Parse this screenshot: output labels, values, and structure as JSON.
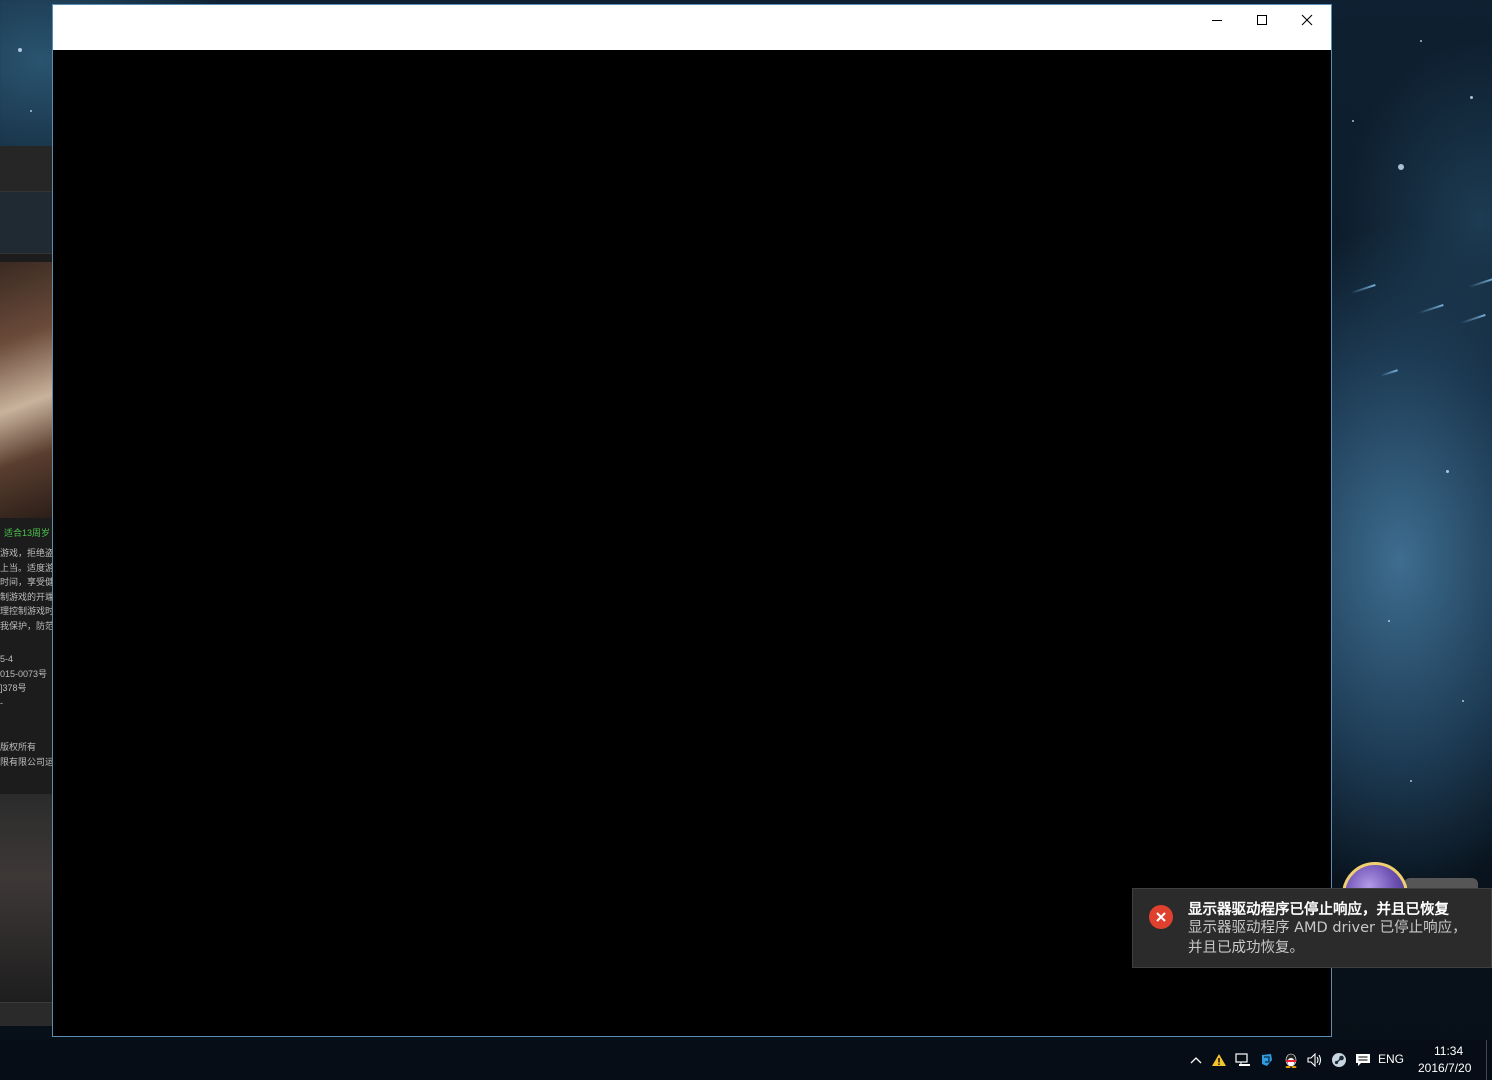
{
  "window": {
    "title": "",
    "buttons": {
      "minimize": "minimize-icon",
      "maximize": "maximize-icon",
      "close": "close-icon"
    }
  },
  "background_app": {
    "age_rating": "适合13周岁",
    "notice_lines": [
      "游戏，拒绝盗",
      "上当。适度游",
      "时间，享受健",
      "制游戏的开端",
      "理控制游戏时",
      "我保护，防范"
    ],
    "license_lines": [
      "5-4",
      "015-0073号",
      "]378号",
      "-"
    ],
    "copyright_lines": [
      "版权所有",
      "限有限公司运"
    ]
  },
  "toast": {
    "icon": "error-x-icon",
    "title": "显示器驱动程序已停止响应，并且已恢复",
    "body": "显示器驱动程序 AMD driver 已停止响应，并且已成功恢复。",
    "colors": {
      "background": "#2b2b2b",
      "icon": "#e0412f"
    }
  },
  "taskbar": {
    "tray_icons": [
      "chevron-up-icon",
      "warning-icon",
      "network-icon",
      "cloud-app-icon",
      "qq-penguin-icon",
      "volume-icon",
      "steam-icon",
      "action-center-icon"
    ],
    "language": "ENG",
    "time": "11:34",
    "date": "2016/7/20"
  }
}
